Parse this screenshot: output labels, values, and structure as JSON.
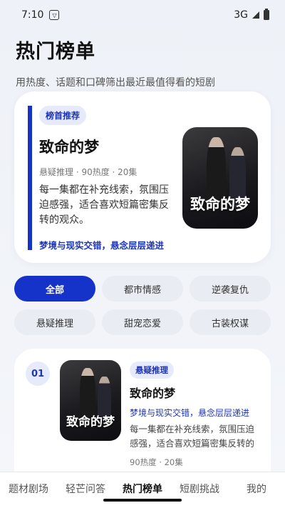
{
  "status_bar": {
    "time": "7:10",
    "network": "3G"
  },
  "header": {
    "title": "热门榜单",
    "subtitle": "用热度、话题和口碑筛出最近最值得看的短剧"
  },
  "featured": {
    "badge": "榜首推荐",
    "title": "致命的梦",
    "meta": "悬疑推理 · 90热度 · 20集",
    "description": "每一集都在补充线索，氛围压迫感强，适合喜欢短篇密集反转的观众。",
    "tagline": "梦境与现实交错，悬念层层递进",
    "poster_text": "致命的梦"
  },
  "filters": [
    {
      "label": "全部",
      "active": true
    },
    {
      "label": "都市情感",
      "active": false
    },
    {
      "label": "逆袭复仇",
      "active": false
    },
    {
      "label": "悬疑推理",
      "active": false
    },
    {
      "label": "甜宠恋爱",
      "active": false
    },
    {
      "label": "古装权谋",
      "active": false
    }
  ],
  "ranking": [
    {
      "rank": "01",
      "badge": "悬疑推理",
      "title": "致命的梦",
      "tagline": "梦境与现实交错，悬念层层递进",
      "description": "每一集都在补充线索，氛围压迫感强，适合喜欢短篇密集反转的观...",
      "meta": "90热度 · 20集",
      "poster_text": "致命的梦"
    }
  ],
  "tabs": [
    {
      "label": "题材剧场",
      "active": false
    },
    {
      "label": "轻芒问答",
      "active": false
    },
    {
      "label": "热门榜单",
      "active": true
    },
    {
      "label": "短剧挑战",
      "active": false
    },
    {
      "label": "我的",
      "active": false
    }
  ],
  "colors": {
    "accent": "#1633c9",
    "badge_bg": "#e6eafb",
    "chip_bg": "#e9ecf2"
  }
}
